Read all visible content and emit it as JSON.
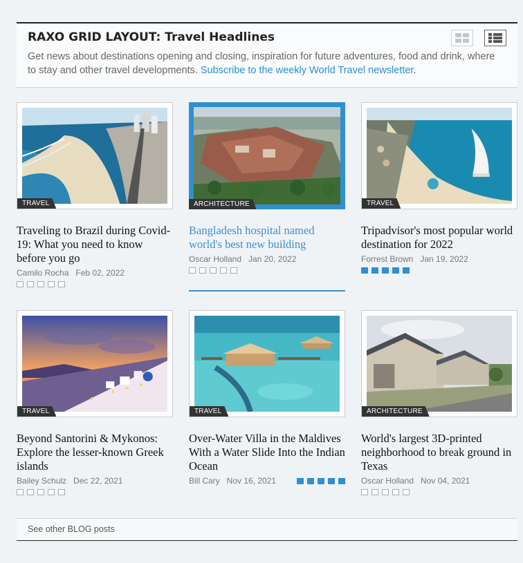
{
  "header": {
    "title": "RAXO GRID LAYOUT: Travel Headlines",
    "description": "Get news about destinations opening and closing, inspiration for future adventures, food and drink, where to stay and other travel developments.",
    "link_text": "Subscribe to the weekly World Travel newsletter",
    "link_suffix": "."
  },
  "view_toggle": {
    "grid_icon": "grid-view-icon",
    "list_icon": "list-view-icon",
    "selected": "list"
  },
  "articles": [
    {
      "category": "TRAVEL",
      "title": "Traveling to Brazil during Covid-19: What you need to know before you go",
      "author": "Camilo Rocha",
      "date": "Feb 02, 2022",
      "rating": 0,
      "rating_max": 5,
      "active": false
    },
    {
      "category": "ARCHITECTURE",
      "title": "Bangladesh hospital named world's best new building",
      "author": "Oscar Holland",
      "date": "Jan 20, 2022",
      "rating": 0,
      "rating_max": 5,
      "active": true
    },
    {
      "category": "TRAVEL",
      "title": "Tripadvisor's most popular world destination for 2022",
      "author": "Forrest Brown",
      "date": "Jan 19, 2022",
      "rating": 5,
      "rating_max": 5,
      "active": false
    },
    {
      "category": "TRAVEL",
      "title": "Beyond Santorini & Mykonos: Explore the lesser-known Greek islands",
      "author": "Bailey Schulz",
      "date": "Dec 22, 2021",
      "rating": 0,
      "rating_max": 5,
      "active": false
    },
    {
      "category": "TRAVEL",
      "title": "Over-Water Villa in the Maldives With a Water Slide Into the Indian Ocean",
      "author": "Bill Cary",
      "date": "Nov 16, 2021",
      "rating": 5,
      "rating_max": 5,
      "active": false
    },
    {
      "category": "ARCHITECTURE",
      "title": "World's largest 3D-printed neighborhood to break ground in Texas",
      "author": "Oscar Holland",
      "date": "Nov 04, 2021",
      "rating": 0,
      "rating_max": 5,
      "active": false
    }
  ],
  "footer": {
    "link_text": "See other BLOG posts"
  },
  "colors": {
    "accent": "#2f8fd3",
    "tag_bg": "#333333",
    "border_dark": "#222222"
  }
}
